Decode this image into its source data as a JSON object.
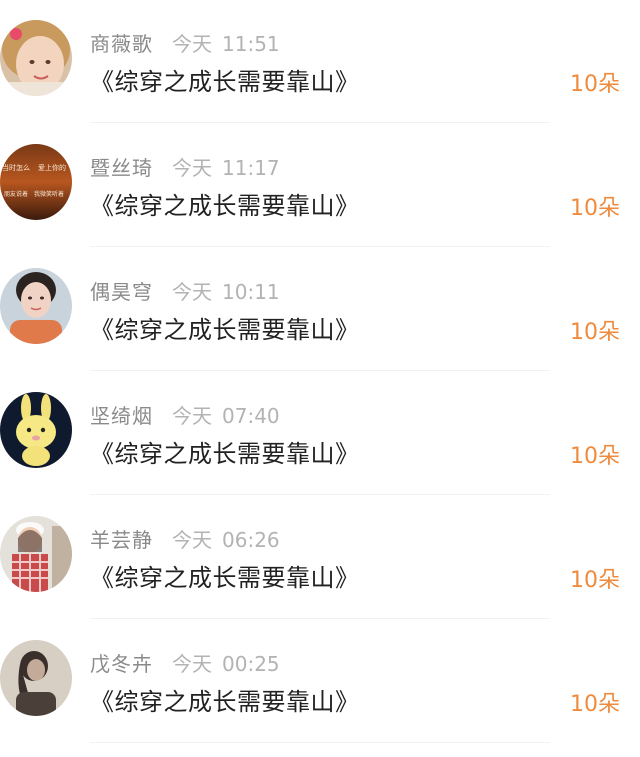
{
  "colors": {
    "name": "#8a8a8a",
    "time": "#b3b3b3",
    "title": "#222222",
    "count": "#f08a3c"
  },
  "items": [
    {
      "name": "商薇歌",
      "day": "今天",
      "time": "11:51",
      "title": "《综穿之成长需要靠山》",
      "count": "10朵",
      "avatar": "girl-portrait-avatar"
    },
    {
      "name": "暨丝琦",
      "day": "今天",
      "time": "11:17",
      "title": "《综穿之成长需要靠山》",
      "count": "10朵",
      "avatar": "sunset-text-avatar",
      "avatar_text": [
        "当时怎么",
        "爱上你的",
        "朋友说着",
        "我微笑听着"
      ]
    },
    {
      "name": "偶昊穹",
      "day": "今天",
      "time": "10:11",
      "title": "《综穿之成长需要靠山》",
      "count": "10朵",
      "avatar": "woman-selfie-avatar"
    },
    {
      "name": "坚绮烟",
      "day": "今天",
      "time": "07:40",
      "title": "《综穿之成长需要靠山》",
      "count": "10朵",
      "avatar": "yellow-bunny-avatar"
    },
    {
      "name": "羊芸静",
      "day": "今天",
      "time": "06:26",
      "title": "《综穿之成长需要靠山》",
      "count": "10朵",
      "avatar": "girl-checkered-shirt-avatar"
    },
    {
      "name": "戊冬卉",
      "day": "今天",
      "time": "00:25",
      "title": "《综穿之成长需要靠山》",
      "count": "10朵",
      "avatar": "girl-silhouette-avatar"
    }
  ]
}
